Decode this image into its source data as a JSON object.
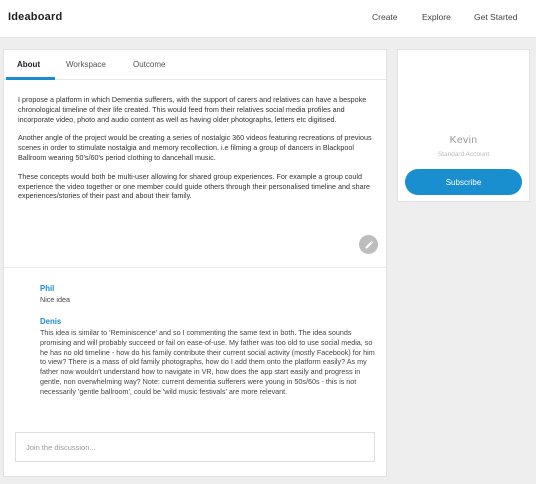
{
  "header": {
    "brand": "Ideaboard",
    "nav": {
      "create": "Create",
      "explore": "Explore",
      "get_started": "Get Started"
    }
  },
  "tabs": {
    "about": "About",
    "workspace": "Workspace",
    "outcome": "Outcome",
    "active": "About"
  },
  "description": {
    "p1": "I propose a platform in which Dementia sufferers, with the support of carers and relatives can have a bespoke chronological timeline of their life created. This would feed from their relatives social media profiles and incorporate video, photo and audio content as well as having older photographs, letters etc digitised.",
    "p2": "Another angle of the project would be creating a series of nostalgic 360 videos featuring recreations of previous scenes in order to stimulate nostalgia and memory recollection. i.e filming a group of dancers in Blackpool Ballroom wearing 50's/60's period clothing to dancehall music.",
    "p3": "These concepts would both be multi-user allowing for shared group experiences. For example a group could experience the video together or one member could guide others through their personalised timeline and share experiences/stories of their past and about their family."
  },
  "comments": [
    {
      "author": "Phil",
      "text": "Nice idea"
    },
    {
      "author": "Denis",
      "text": "This idea is similar to 'Reminiscence' and so I commenting the same text in both. The idea sounds promising and will probably succeed or fail on ease-of-use. My father was too old to use social media, so he has no old timeline - how do his family contribute their current social activity (mostly Facebook) for him to view? There is a mass of old family photographs, how do I add them onto the platform easily? As my father now wouldn't understand how to navigate in VR, how does the app start easily and progress in gentle, non overwhelming way? Note: current dementia sufferers were young in 50s/60s - this is not necessarily 'gentle ballroom', could be 'wild music festivals' are more relevant."
    }
  ],
  "join": {
    "placeholder": "Join the discussion..."
  },
  "profile": {
    "name": "Kevin",
    "role": "Standard Account",
    "subscribe_label": "Subscribe"
  },
  "colors": {
    "accent": "#1a8fd0",
    "background": "#eeeeee"
  },
  "icons": {
    "edit": "pencil-icon"
  }
}
